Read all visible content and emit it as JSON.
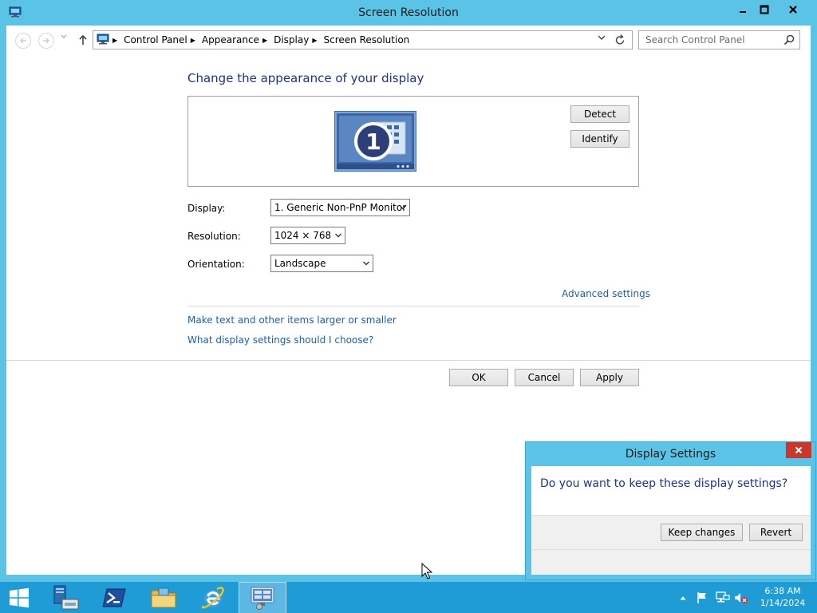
{
  "window": {
    "title": "Screen Resolution",
    "minimize_glyph": "—",
    "close_glyph": "✕"
  },
  "address_bar": {
    "crumbs": [
      "Control Panel",
      "Appearance",
      "Display",
      "Screen Resolution"
    ],
    "icons": [
      "control-panel-icon",
      "dropdown-icon",
      "refresh-icon"
    ]
  },
  "search": {
    "placeholder": "Search Control Panel"
  },
  "main": {
    "heading": "Change the appearance of your display",
    "monitor_number": "1",
    "detect_label": "Detect",
    "identify_label": "Identify",
    "display_label": "Display:",
    "display_value": "1. Generic Non-PnP Monitor",
    "resolution_label": "Resolution:",
    "resolution_value": "1024 × 768",
    "orientation_label": "Orientation:",
    "orientation_value": "Landscape",
    "advanced_link": "Advanced settings",
    "text_size_link": "Make text and other items larger or smaller",
    "help_link": "What display settings should I choose?",
    "ok_label": "OK",
    "cancel_label": "Cancel",
    "apply_label": "Apply"
  },
  "dialog": {
    "title": "Display Settings",
    "message": "Do you want to keep these display settings?",
    "keep_label": "Keep changes",
    "revert_label": "Revert",
    "close_glyph": "✕"
  },
  "taskbar": {
    "items": [
      "start-icon",
      "server-manager-icon",
      "powershell-icon",
      "file-explorer-icon",
      "internet-explorer-icon",
      "display-settings-icon"
    ],
    "time": "6:38 AM",
    "date": "1/14/2024"
  },
  "colors": {
    "chrome": "#5bc3e6",
    "taskbar": "#1f9bd6",
    "heading": "#1e3287",
    "link": "#1f5fa8",
    "close_red": "#c7372d"
  }
}
